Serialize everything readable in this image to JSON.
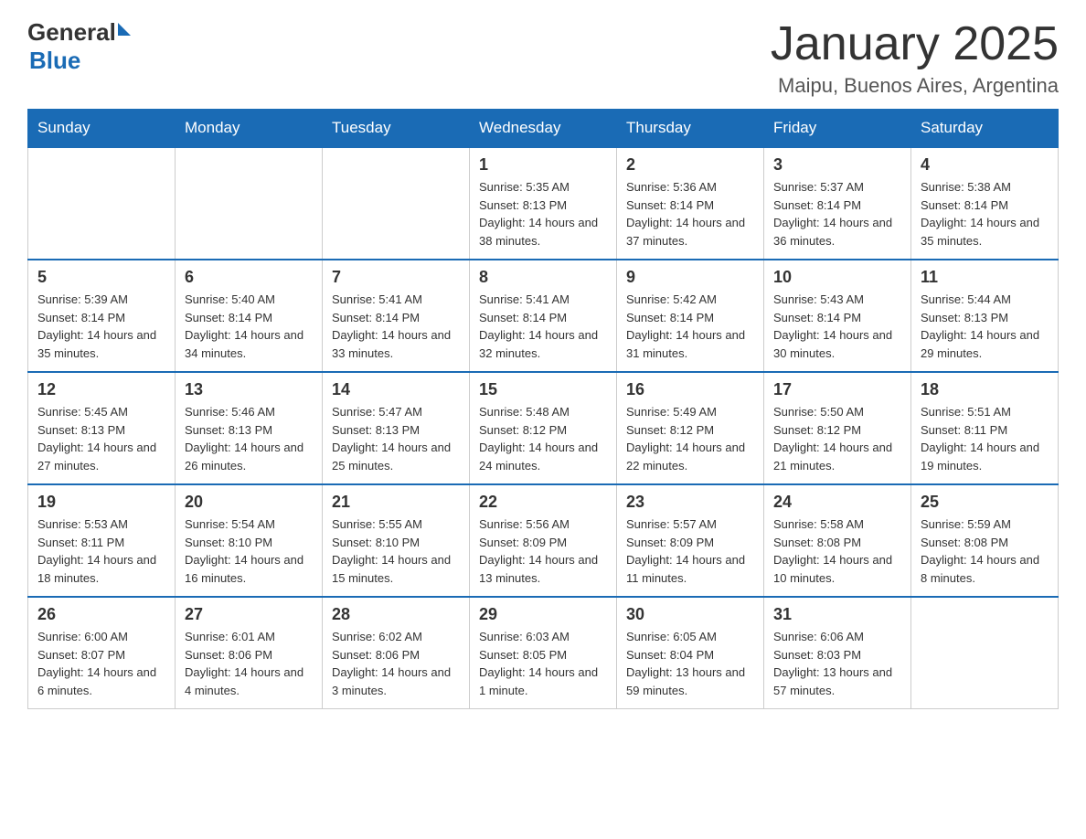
{
  "header": {
    "logo": {
      "general": "General",
      "blue": "Blue",
      "triangle": true
    },
    "title": "January 2025",
    "subtitle": "Maipu, Buenos Aires, Argentina"
  },
  "weekdays": [
    "Sunday",
    "Monday",
    "Tuesday",
    "Wednesday",
    "Thursday",
    "Friday",
    "Saturday"
  ],
  "weeks": [
    [
      {
        "day": "",
        "info": ""
      },
      {
        "day": "",
        "info": ""
      },
      {
        "day": "",
        "info": ""
      },
      {
        "day": "1",
        "info": "Sunrise: 5:35 AM\nSunset: 8:13 PM\nDaylight: 14 hours and 38 minutes."
      },
      {
        "day": "2",
        "info": "Sunrise: 5:36 AM\nSunset: 8:14 PM\nDaylight: 14 hours and 37 minutes."
      },
      {
        "day": "3",
        "info": "Sunrise: 5:37 AM\nSunset: 8:14 PM\nDaylight: 14 hours and 36 minutes."
      },
      {
        "day": "4",
        "info": "Sunrise: 5:38 AM\nSunset: 8:14 PM\nDaylight: 14 hours and 35 minutes."
      }
    ],
    [
      {
        "day": "5",
        "info": "Sunrise: 5:39 AM\nSunset: 8:14 PM\nDaylight: 14 hours and 35 minutes."
      },
      {
        "day": "6",
        "info": "Sunrise: 5:40 AM\nSunset: 8:14 PM\nDaylight: 14 hours and 34 minutes."
      },
      {
        "day": "7",
        "info": "Sunrise: 5:41 AM\nSunset: 8:14 PM\nDaylight: 14 hours and 33 minutes."
      },
      {
        "day": "8",
        "info": "Sunrise: 5:41 AM\nSunset: 8:14 PM\nDaylight: 14 hours and 32 minutes."
      },
      {
        "day": "9",
        "info": "Sunrise: 5:42 AM\nSunset: 8:14 PM\nDaylight: 14 hours and 31 minutes."
      },
      {
        "day": "10",
        "info": "Sunrise: 5:43 AM\nSunset: 8:14 PM\nDaylight: 14 hours and 30 minutes."
      },
      {
        "day": "11",
        "info": "Sunrise: 5:44 AM\nSunset: 8:13 PM\nDaylight: 14 hours and 29 minutes."
      }
    ],
    [
      {
        "day": "12",
        "info": "Sunrise: 5:45 AM\nSunset: 8:13 PM\nDaylight: 14 hours and 27 minutes."
      },
      {
        "day": "13",
        "info": "Sunrise: 5:46 AM\nSunset: 8:13 PM\nDaylight: 14 hours and 26 minutes."
      },
      {
        "day": "14",
        "info": "Sunrise: 5:47 AM\nSunset: 8:13 PM\nDaylight: 14 hours and 25 minutes."
      },
      {
        "day": "15",
        "info": "Sunrise: 5:48 AM\nSunset: 8:12 PM\nDaylight: 14 hours and 24 minutes."
      },
      {
        "day": "16",
        "info": "Sunrise: 5:49 AM\nSunset: 8:12 PM\nDaylight: 14 hours and 22 minutes."
      },
      {
        "day": "17",
        "info": "Sunrise: 5:50 AM\nSunset: 8:12 PM\nDaylight: 14 hours and 21 minutes."
      },
      {
        "day": "18",
        "info": "Sunrise: 5:51 AM\nSunset: 8:11 PM\nDaylight: 14 hours and 19 minutes."
      }
    ],
    [
      {
        "day": "19",
        "info": "Sunrise: 5:53 AM\nSunset: 8:11 PM\nDaylight: 14 hours and 18 minutes."
      },
      {
        "day": "20",
        "info": "Sunrise: 5:54 AM\nSunset: 8:10 PM\nDaylight: 14 hours and 16 minutes."
      },
      {
        "day": "21",
        "info": "Sunrise: 5:55 AM\nSunset: 8:10 PM\nDaylight: 14 hours and 15 minutes."
      },
      {
        "day": "22",
        "info": "Sunrise: 5:56 AM\nSunset: 8:09 PM\nDaylight: 14 hours and 13 minutes."
      },
      {
        "day": "23",
        "info": "Sunrise: 5:57 AM\nSunset: 8:09 PM\nDaylight: 14 hours and 11 minutes."
      },
      {
        "day": "24",
        "info": "Sunrise: 5:58 AM\nSunset: 8:08 PM\nDaylight: 14 hours and 10 minutes."
      },
      {
        "day": "25",
        "info": "Sunrise: 5:59 AM\nSunset: 8:08 PM\nDaylight: 14 hours and 8 minutes."
      }
    ],
    [
      {
        "day": "26",
        "info": "Sunrise: 6:00 AM\nSunset: 8:07 PM\nDaylight: 14 hours and 6 minutes."
      },
      {
        "day": "27",
        "info": "Sunrise: 6:01 AM\nSunset: 8:06 PM\nDaylight: 14 hours and 4 minutes."
      },
      {
        "day": "28",
        "info": "Sunrise: 6:02 AM\nSunset: 8:06 PM\nDaylight: 14 hours and 3 minutes."
      },
      {
        "day": "29",
        "info": "Sunrise: 6:03 AM\nSunset: 8:05 PM\nDaylight: 14 hours and 1 minute."
      },
      {
        "day": "30",
        "info": "Sunrise: 6:05 AM\nSunset: 8:04 PM\nDaylight: 13 hours and 59 minutes."
      },
      {
        "day": "31",
        "info": "Sunrise: 6:06 AM\nSunset: 8:03 PM\nDaylight: 13 hours and 57 minutes."
      },
      {
        "day": "",
        "info": ""
      }
    ]
  ]
}
